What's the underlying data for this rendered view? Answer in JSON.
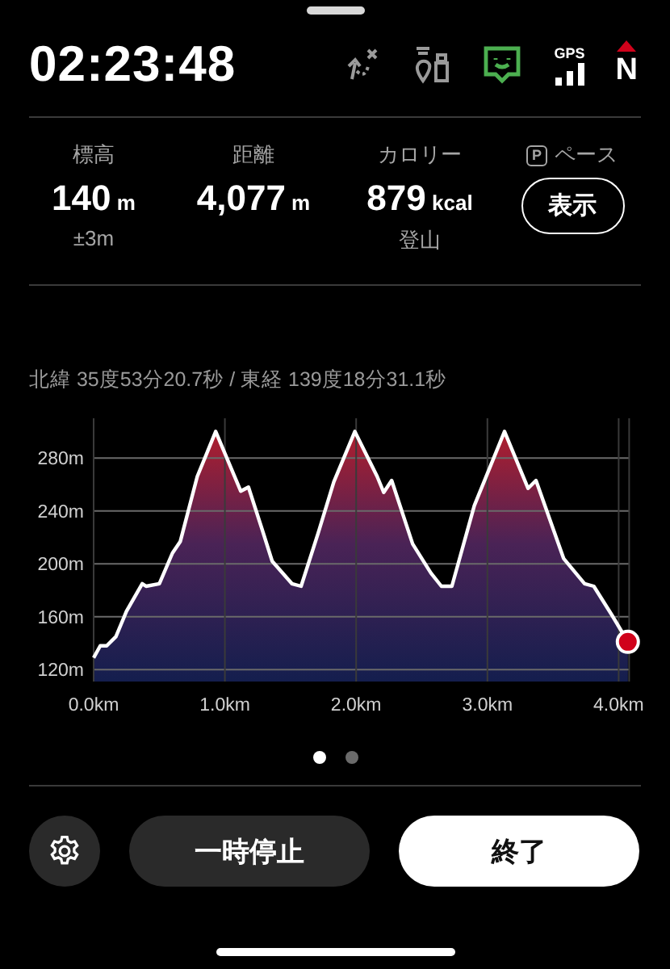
{
  "header": {
    "time": "02:23:48",
    "status_icons": [
      {
        "kind": "route"
      },
      {
        "kind": "pins"
      },
      {
        "kind": "face",
        "color": "#4caf50"
      },
      {
        "kind": "gps",
        "label": "GPS"
      },
      {
        "kind": "compass",
        "label": "N"
      }
    ]
  },
  "stats": [
    {
      "label": "標高",
      "value": "140",
      "unit": "m",
      "sub": "±3m"
    },
    {
      "label": "距離",
      "value": "4,077",
      "unit": "m"
    },
    {
      "label": "カロリー",
      "value": "879",
      "unit": "kcal",
      "sub": "登山"
    }
  ],
  "pace": {
    "badge": "P",
    "label": "ペース",
    "button": "表示"
  },
  "coordinates": "北緯 35度53分20.7秒 / 東経 139度18分31.1秒",
  "chart_data": {
    "type": "area",
    "x": [
      0,
      0.05,
      0.1,
      0.17,
      0.25,
      0.37,
      0.4,
      0.5,
      0.6,
      0.66,
      0.79,
      0.93,
      1.12,
      1.18,
      1.28,
      1.36,
      1.51,
      1.58,
      1.71,
      1.83,
      1.99,
      2.16,
      2.21,
      2.27,
      2.43,
      2.57,
      2.65,
      2.73,
      2.9,
      3.13,
      3.31,
      3.37,
      3.58,
      3.74,
      3.81,
      3.95,
      4.07
    ],
    "grid": true,
    "series": [
      {
        "color": "#ffffff",
        "values": [
          129,
          138,
          138,
          145,
          164,
          185,
          183,
          185,
          208,
          217,
          266,
          300,
          255,
          258,
          227,
          202,
          185,
          183,
          223,
          262,
          300,
          266,
          254,
          263,
          215,
          193,
          183,
          183,
          244,
          300,
          257,
          263,
          204,
          185,
          183,
          161,
          141
        ]
      }
    ],
    "xlim": [
      0,
      4.08
    ],
    "ylim": [
      111,
      310
    ],
    "xticks": [
      {
        "value": 0,
        "label": "0.0km"
      },
      {
        "value": 1,
        "label": "1.0km"
      },
      {
        "value": 2,
        "label": "2.0km"
      },
      {
        "value": 3,
        "label": "3.0km"
      },
      {
        "value": 4,
        "label": "4.0km"
      }
    ],
    "yticks": [
      {
        "value": 120,
        "label": "120m"
      },
      {
        "value": 160,
        "label": "160m"
      },
      {
        "value": 200,
        "label": "200m"
      },
      {
        "value": 240,
        "label": "240m"
      },
      {
        "value": 280,
        "label": "280m"
      }
    ]
  },
  "pages": [
    {
      "selected": true
    },
    {
      "selected": false
    }
  ],
  "buttons": [
    {
      "kind": "settings"
    },
    {
      "kind": "dark",
      "label": "一時停止"
    },
    {
      "kind": "light",
      "label": "終了"
    }
  ]
}
